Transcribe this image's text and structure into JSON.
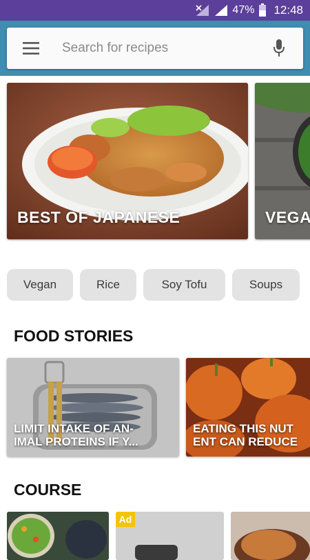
{
  "status_bar": {
    "battery": "47%",
    "time": "12:48"
  },
  "search": {
    "placeholder": "Search for recipes",
    "icons": [
      "menu-icon",
      "mic-icon"
    ]
  },
  "featured": [
    {
      "caption": "BEST OF JAPANESE"
    },
    {
      "caption": "VEGA"
    }
  ],
  "chips": [
    "Vegan",
    "Rice",
    "Soy Tofu",
    "Soups"
  ],
  "sections": {
    "food_stories": "FOOD STORIES",
    "course": "COURSE"
  },
  "stories": [
    {
      "caption": "LIMIT INTAKE OF AN-\nIMAL PROTEINS IF Y..."
    },
    {
      "caption": "EATING THIS NUT\nENT CAN REDUCE"
    }
  ],
  "course": {
    "ad_label": "Ad"
  },
  "colors": {
    "status_bar": "#5b3f9a",
    "header": "#3f8db0",
    "chip": "#e3e3e3",
    "ad_badge": "#f5c400"
  }
}
